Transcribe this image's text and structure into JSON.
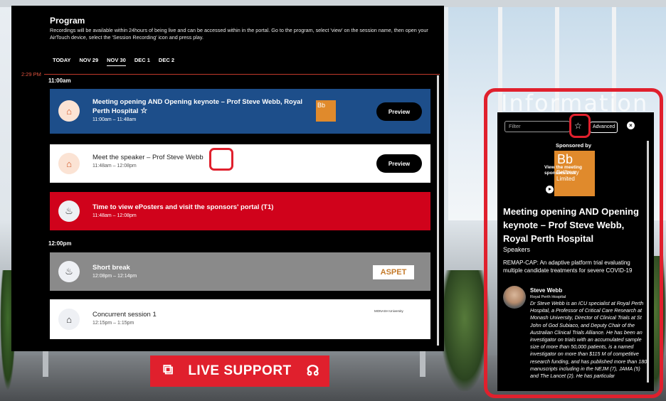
{
  "program": {
    "title": "Program",
    "description": "Recordings will be available within 24hours of being live and can be accessed within in the portal. Go to the program, select 'view' on the session name, then open your AirTouch device, select the 'Session Recording' icon and press play.",
    "tabs": [
      "TODAY",
      "NOV 29",
      "NOV 30",
      "DEC 1",
      "DEC 2"
    ],
    "active_tab": "NOV 30",
    "current_time": "2:29 PM",
    "time_headers": [
      "11:00am",
      "12:00pm"
    ],
    "sessions": [
      {
        "title": "Meeting opening AND Opening keynote – Prof Steve Webb, Royal Perth Hospital",
        "time": "11:00am – 11:48am",
        "bg": "#1d4e8a",
        "action": "Preview",
        "icon": "presentation-icon"
      },
      {
        "title": "Meet the speaker – Prof Steve Webb",
        "time": "11:48am – 12:08pm",
        "bg": "#ffffff",
        "action": "Preview",
        "icon": "presentation-icon"
      },
      {
        "title": "Time to view ePosters and visit the sponsors' portal (T1)",
        "time": "11:48am – 12:08pm",
        "bg": "#d0021b",
        "icon": "break-icon"
      },
      {
        "title": "Short break",
        "time": "12:08pm – 12:14pm",
        "bg": "#8a8a8a",
        "logo": "ASPET",
        "icon": "break-icon"
      },
      {
        "title": "Concurrent session 1",
        "time": "12:15pm – 1:15pm",
        "bg": "#ffffff",
        "logo": "MONASH University",
        "icon": "presentation-icon"
      }
    ]
  },
  "info": {
    "bg_title": "Information",
    "filter_placeholder": "Filter",
    "advanced_label": "Advanced",
    "sponsored_by": "Sponsored by",
    "sponsor_logo": {
      "mark": "Bb",
      "name": "Bellberry Limited"
    },
    "sponsor_overlay": "View the meeting sponsors Visit",
    "session_title": "Meeting opening AND Opening keynote – Prof Steve Webb, Royal Perth Hospital",
    "speakers_label": "Speakers",
    "abstract": "REMAP-CAP: An adaptive platform trial evaluating multiple candidate treatments for severe COVID-19",
    "speaker": {
      "name": "Steve Webb",
      "org": "Royal Perth Hospital",
      "bio": "Dr Steve Webb is an ICU specialist at Royal Perth Hospital, a Professor of Critical Care Research at Monash University, Director of Clinical Trials at St John of God Subiaco, and Deputy Chair of the Australian Clinical Trials Alliance. He has been an investigator on trials with an accumulated sample size of more than 50,000 patients, is a named investigator on more than $115 M of competitive research funding, and has published more than 180 manuscripts including in the NEJM (7), JAMA (5) and The Lancet (2). He has particular"
    }
  },
  "live_support": {
    "label": "LIVE SUPPORT"
  },
  "colors": {
    "accent_red": "#e0202d",
    "card_blue": "#1d4e8a",
    "card_red": "#d0021b",
    "card_grey": "#8a8a8a"
  }
}
